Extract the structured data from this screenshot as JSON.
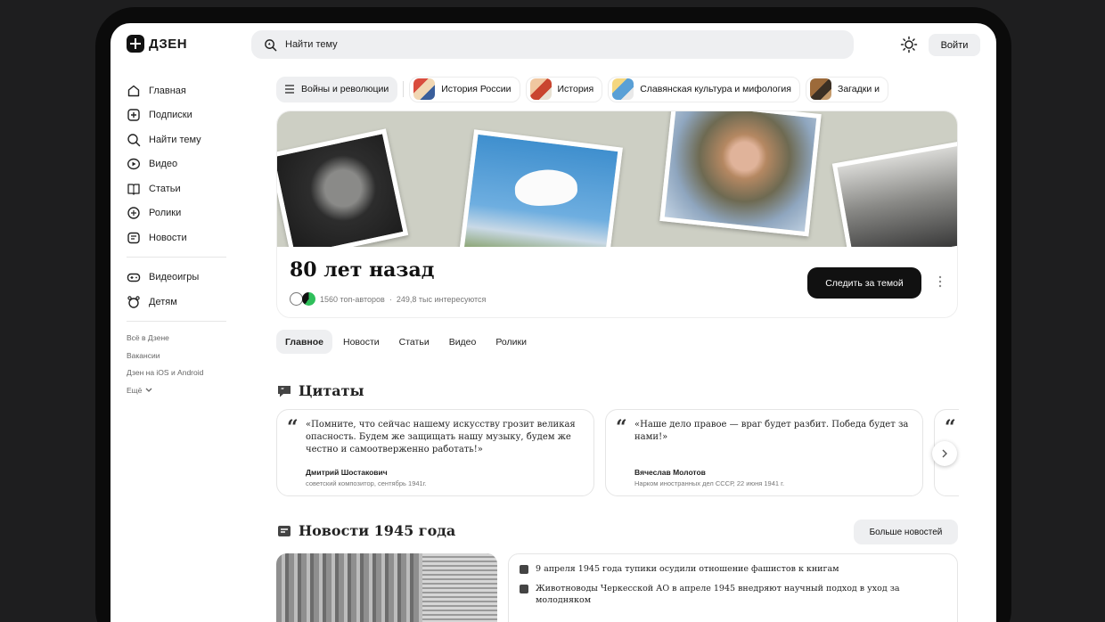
{
  "app": {
    "logo_text": "ДЗЕН",
    "search_placeholder": "Найти тему",
    "login_label": "Войти"
  },
  "sidebar": {
    "items": [
      {
        "label": "Главная",
        "icon": "home-icon"
      },
      {
        "label": "Подписки",
        "icon": "subscriptions-icon"
      },
      {
        "label": "Найти тему",
        "icon": "find-topic-icon"
      },
      {
        "label": "Видео",
        "icon": "video-icon"
      },
      {
        "label": "Статьи",
        "icon": "articles-icon"
      },
      {
        "label": "Ролики",
        "icon": "shorts-icon"
      },
      {
        "label": "Новости",
        "icon": "news-icon"
      }
    ],
    "extra_items": [
      {
        "label": "Видеоигры",
        "icon": "gamepad-icon"
      },
      {
        "label": "Детям",
        "icon": "kids-icon"
      }
    ],
    "links": [
      "Всё в Дзене",
      "Вакансии",
      "Дзен на iOS и Android",
      "Ещё"
    ]
  },
  "topics": [
    {
      "label": "Войны и революции",
      "active": true
    },
    {
      "label": "История России",
      "active": false
    },
    {
      "label": "История",
      "active": false
    },
    {
      "label": "Славянская культура и мифология",
      "active": false
    },
    {
      "label": "Загадки и",
      "active": false
    }
  ],
  "hero": {
    "title": "80 лет назад",
    "authors": "1560 топ-авторов",
    "interested": "249,8 тыс интересуются",
    "separator": "·",
    "follow_label": "Следить за темой"
  },
  "tabs": [
    "Главное",
    "Новости",
    "Статьи",
    "Видео",
    "Ролики"
  ],
  "quotes_section": {
    "title": "Цитаты",
    "items": [
      {
        "text": "«Помните, что сейчас нашему искусству грозит великая опасность. Будем же защищать нашу музыку, будем же честно и самоотверженно работать!»",
        "author": "Дмитрий Шостакович",
        "role": "советский композитор, сентябрь 1941г."
      },
      {
        "text": "«Наше дело правое — враг будет разбит. Победа будет за нами!»",
        "author": "Вячеслав Молотов",
        "role": "Нарком иностранных дел СССР, 22 июня 1941 г."
      }
    ]
  },
  "news_section": {
    "title": "Новости 1945 года",
    "more_label": "Больше новостей",
    "items": [
      "9 апреля 1945 года тупики осудили отношение фашистов к книгам",
      "Животноводы Черкесской АО в апреле 1945 внедряют научный подход в уход за молодняком"
    ]
  },
  "colors": {
    "accent": "#111111",
    "chip_bg": "#eeeff1",
    "page_bg": "#1e1e1f"
  }
}
